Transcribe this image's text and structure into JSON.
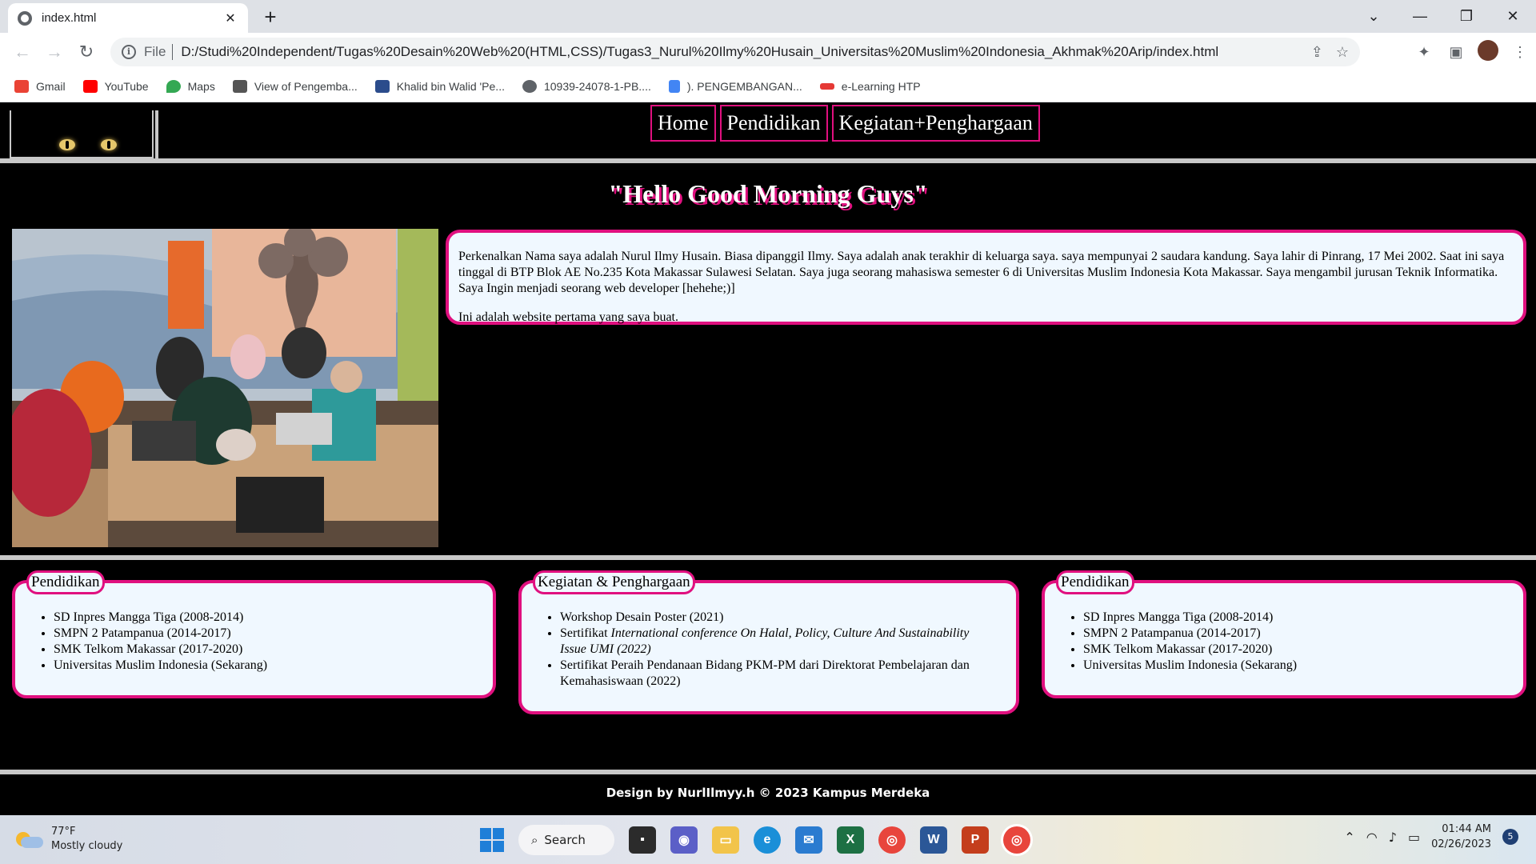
{
  "browser": {
    "tab_title": "index.html",
    "url_scheme": "File",
    "url": "D:/Studi%20Independent/Tugas%20Desain%20Web%20(HTML,CSS)/Tugas3_Nurul%20Ilmy%20Husain_Universitas%20Muslim%20Indonesia_Akhmak%20Arip/index.html",
    "bookmarks": [
      {
        "label": "Gmail",
        "icon": "gmail-icon",
        "color": "#ea4335"
      },
      {
        "label": "YouTube",
        "icon": "youtube-icon",
        "color": "#ff0000"
      },
      {
        "label": "Maps",
        "icon": "maps-icon",
        "color": "#34a853"
      },
      {
        "label": "View of Pengemba...",
        "icon": "pkp-icon",
        "color": "#555555"
      },
      {
        "label": "Khalid bin Walid 'Pe...",
        "icon": "site-icon",
        "color": "#2b4c8c"
      },
      {
        "label": "10939-24078-1-PB....",
        "icon": "globe-icon",
        "color": "#5f6368"
      },
      {
        "label": "). PENGEMBANGAN...",
        "icon": "doc-icon",
        "color": "#4285f4"
      },
      {
        "label": "e-Learning HTP",
        "icon": "elearning-icon",
        "color": "#e53935"
      }
    ]
  },
  "site": {
    "nav": [
      "Home",
      "Pendidikan",
      "Kegiatan+Penghargaan"
    ],
    "headline": "\"Hello Good Morning Guys\"",
    "intro_p1": "Perkenalkan Nama saya adalah Nurul Ilmy Husain. Biasa dipanggil Ilmy. Saya adalah anak terakhir di keluarga saya. saya mempunyai 2 saudara kandung. Saya lahir di Pinrang, 17 Mei 2002. Saat ini saya tinggal di BTP Blok AE No.235 Kota Makassar Sulawesi Selatan. Saya juga seorang mahasiswa semester 6 di Universitas Muslim Indonesia Kota Makassar. Saya mengambil jurusan Teknik Informatika. Saya Ingin menjadi seorang web developer [hehehe;)]",
    "intro_p2": "Ini adalah website pertama yang saya buat.",
    "cards": [
      {
        "legend": "Pendidikan",
        "items": [
          "SD Inpres Mangga Tiga (2008-2014)",
          "SMPN 2 Patampanua (2014-2017)",
          "SMK Telkom Makassar (2017-2020)",
          "Universitas Muslim Indonesia (Sekarang)"
        ]
      },
      {
        "legend": "Kegiatan & Penghargaan",
        "item1": "Workshop Desain Poster (2021)",
        "item2_prefix": "Sertifikat ",
        "item2_italic": "International conference On Halal, Policy, Culture And Sustainability Issue UMI (2022)",
        "item3": "Sertifikat Peraih Pendanaan Bidang PKM-PM dari Direktorat Pembelajaran dan Kemahasiswaan (2022)"
      },
      {
        "legend": "Pendidikan",
        "items": [
          "SD Inpres Mangga Tiga (2008-2014)",
          "SMPN 2 Patampanua (2014-2017)",
          "SMK Telkom Makassar (2017-2020)",
          "Universitas Muslim Indonesia (Sekarang)"
        ]
      }
    ],
    "footer": "Design by NurlIlmyy.h © 2023 Kampus Merdeka",
    "accent_color": "#e0107f"
  },
  "taskbar": {
    "weather_temp": "77°F",
    "weather_desc": "Mostly cloudy",
    "search_label": "Search",
    "time": "01:44 AM",
    "date": "02/26/2023",
    "notifications": "5"
  }
}
